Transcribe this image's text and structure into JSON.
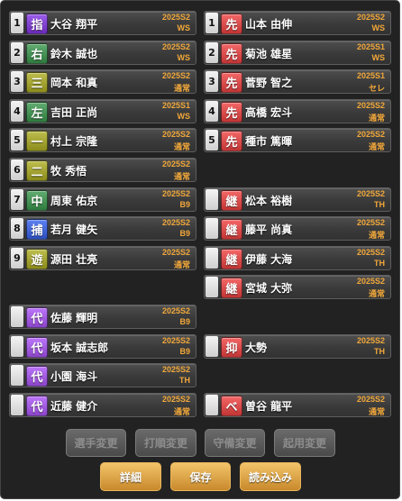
{
  "colors": {
    "pitcher": "#6a2bb8",
    "catcher": "#2c4fbf",
    "infield": "#8c8c1c",
    "outfield": "#2f7a3e",
    "starter": "#c23535",
    "relief": "#c23535",
    "substitute": "#8a44c8",
    "label_accent": "#f2a83a"
  },
  "batting_lineup": [
    {
      "order": "1",
      "position": "指",
      "name": "大谷 翔平",
      "season": "2025S2",
      "card_type": "WS",
      "pos_color": "#6a2bb8"
    },
    {
      "order": "2",
      "position": "右",
      "name": "鈴木 誠也",
      "season": "2025S2",
      "card_type": "WS",
      "pos_color": "#2f7a3e"
    },
    {
      "order": "3",
      "position": "三",
      "name": "岡本 和真",
      "season": "2025S2",
      "card_type": "通常",
      "pos_color": "#8c8c1c"
    },
    {
      "order": "4",
      "position": "左",
      "name": "吉田 正尚",
      "season": "2025S1",
      "card_type": "WS",
      "pos_color": "#2f7a3e"
    },
    {
      "order": "5",
      "position": "一",
      "name": "村上 宗隆",
      "season": "2025S2",
      "card_type": "通常",
      "pos_color": "#8c8c1c"
    },
    {
      "order": "6",
      "position": "二",
      "name": "牧 秀悟",
      "season": "2025S2",
      "card_type": "通常",
      "pos_color": "#8c8c1c"
    },
    {
      "order": "7",
      "position": "中",
      "name": "周東 佑京",
      "season": "2025S2",
      "card_type": "B9",
      "pos_color": "#2f7a3e"
    },
    {
      "order": "8",
      "position": "捕",
      "name": "若月 健矢",
      "season": "2025S2",
      "card_type": "B9",
      "pos_color": "#2c4fbf"
    },
    {
      "order": "9",
      "position": "遊",
      "name": "源田 壮亮",
      "season": "2025S2",
      "card_type": "通常",
      "pos_color": "#8c8c1c"
    }
  ],
  "bench": [
    {
      "position": "代",
      "name": "佐藤 輝明",
      "season": "2025S2",
      "card_type": "B9"
    },
    {
      "position": "代",
      "name": "坂本 誠志郎",
      "season": "2025S2",
      "card_type": "B9"
    },
    {
      "position": "代",
      "name": "小園 海斗",
      "season": "2025S2",
      "card_type": "TH"
    },
    {
      "position": "代",
      "name": "近藤 健介",
      "season": "2025S2",
      "card_type": "通常"
    }
  ],
  "starters": [
    {
      "order": "1",
      "position": "先",
      "name": "山本 由伸",
      "season": "2025S2",
      "card_type": "WS"
    },
    {
      "order": "2",
      "position": "先",
      "name": "菊池 雄星",
      "season": "2025S1",
      "card_type": "WS"
    },
    {
      "order": "3",
      "position": "先",
      "name": "菅野 智之",
      "season": "2025S1",
      "card_type": "セレ"
    },
    {
      "order": "4",
      "position": "先",
      "name": "高橋 宏斗",
      "season": "2025S2",
      "card_type": "通常"
    },
    {
      "order": "5",
      "position": "先",
      "name": "種市 篤暉",
      "season": "2025S2",
      "card_type": "通常"
    }
  ],
  "relievers": [
    {
      "position": "継",
      "name": "松本 裕樹",
      "season": "2025S2",
      "card_type": "TH"
    },
    {
      "position": "継",
      "name": "藤平 尚真",
      "season": "2025S2",
      "card_type": "通常"
    },
    {
      "position": "継",
      "name": "伊藤 大海",
      "season": "2025S2",
      "card_type": "TH"
    },
    {
      "position": "継",
      "name": "宮城 大弥",
      "season": "2025S2",
      "card_type": "通常"
    }
  ],
  "closer": {
    "position": "抑",
    "name": "大勢",
    "season": "2025S2",
    "card_type": "TH"
  },
  "extra_pitcher": {
    "position": "ベ",
    "name": "曽谷 龍平",
    "season": "2025S2",
    "card_type": "通常"
  },
  "actions_disabled": [
    "選手変更",
    "打順変更",
    "守備変更",
    "起用変更"
  ],
  "actions": [
    "詳細",
    "保存",
    "読み込み"
  ]
}
